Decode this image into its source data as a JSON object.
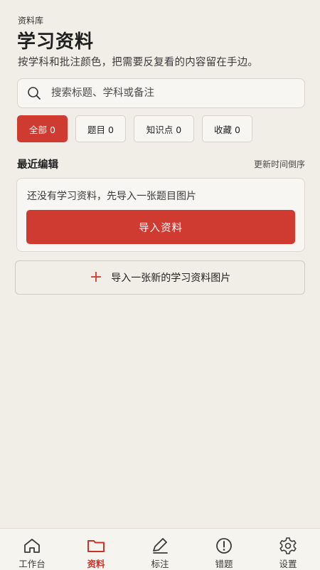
{
  "header": {
    "eyebrow": "资料库",
    "title": "学习资料",
    "subtitle": "按学科和批注颜色，把需要反复看的内容留在手边。"
  },
  "search": {
    "placeholder": "搜索标题、学科或备注",
    "value": ""
  },
  "filters": [
    {
      "label": "全部 0",
      "active": true
    },
    {
      "label": "题目 0",
      "active": false
    },
    {
      "label": "知识点 0",
      "active": false
    },
    {
      "label": "收藏 0",
      "active": false
    }
  ],
  "recent": {
    "title": "最近编辑",
    "sort_label": "更新时间倒序",
    "empty_text": "还没有学习资料，先导入一张题目图片",
    "import_button": "导入资料"
  },
  "add_button": {
    "label": "导入一张新的学习资料图片",
    "icon": "plus-icon"
  },
  "tabbar": {
    "items": [
      {
        "label": "工作台",
        "icon": "home-icon",
        "active": false
      },
      {
        "label": "资料",
        "icon": "folder-icon",
        "active": true
      },
      {
        "label": "标注",
        "icon": "pencil-icon",
        "active": false
      },
      {
        "label": "错题",
        "icon": "alert-circle-icon",
        "active": false
      },
      {
        "label": "设置",
        "icon": "gear-icon",
        "active": false
      }
    ]
  },
  "colors": {
    "background": "#f1eee8",
    "accent": "#cf3a31",
    "text": "#1f1f1f"
  }
}
